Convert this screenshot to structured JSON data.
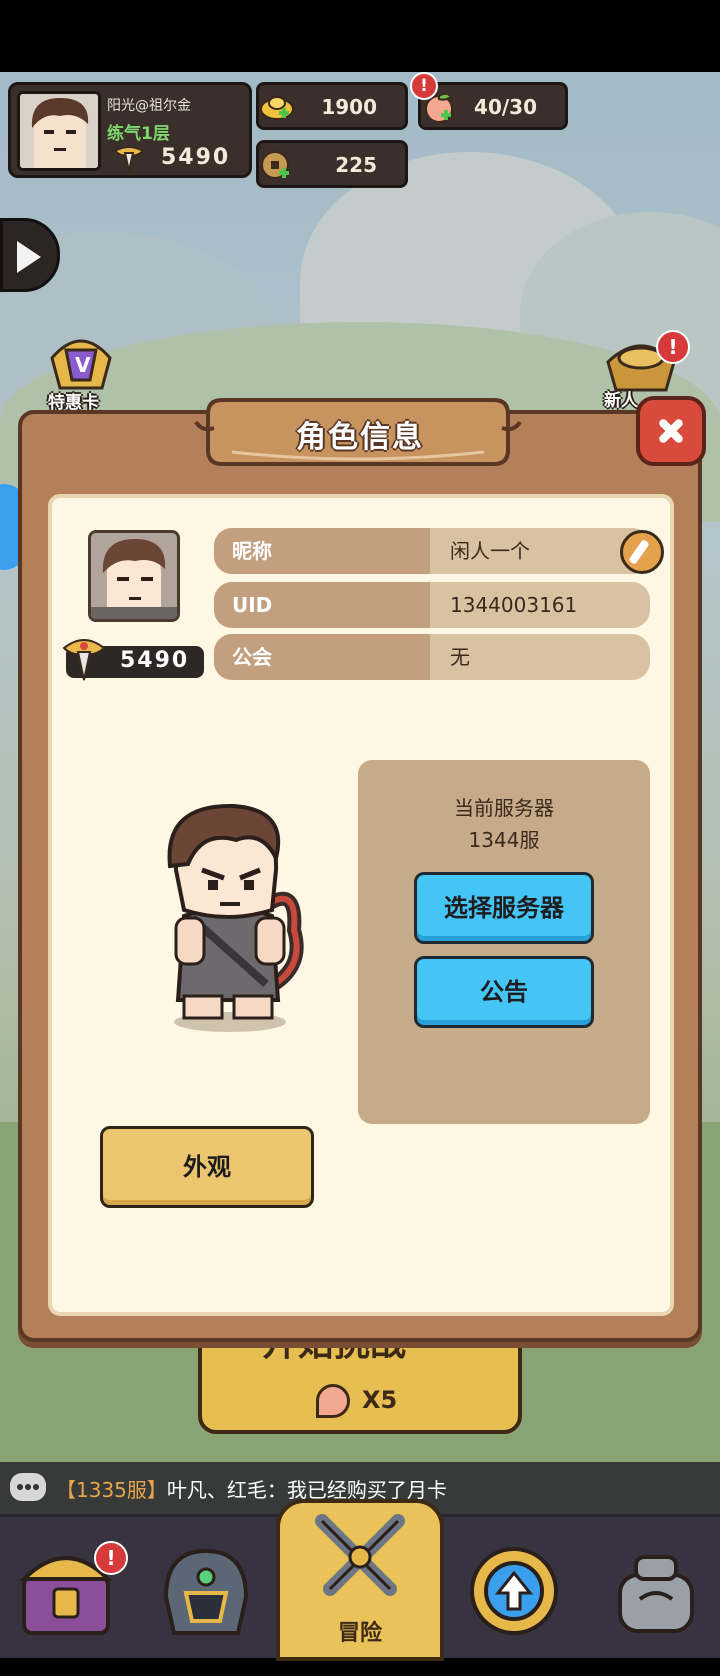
{
  "hud": {
    "player_name": "阳光@祖尔金",
    "player_level": "练气1层",
    "player_power": "5490",
    "gold_ingot": "1900",
    "stamina": "40/30",
    "coins": "225",
    "stamina_badge": "!"
  },
  "side": {
    "special_card_label": "特惠卡",
    "newbie_label": "新人",
    "newbie_badge": "!"
  },
  "dialog": {
    "title": "角色信息",
    "power": "5490",
    "rows": [
      {
        "key": "昵称",
        "value": "闲人一个"
      },
      {
        "key": "UID",
        "value": "1344003161"
      },
      {
        "key": "公会",
        "value": "无"
      }
    ],
    "server_caption": "当前服务器",
    "server_value": "1344服",
    "select_server_label": "选择服务器",
    "notice_label": "公告",
    "appearance_label": "外观"
  },
  "behind": {
    "start_challenge": "开始挑战",
    "cost": "X5"
  },
  "chat": {
    "server_tag": "【1335服】",
    "message": "叶凡、红毛：我已经购买了月卡"
  },
  "nav": {
    "adventure_label": "冒险",
    "shop_badge": "!"
  },
  "colors": {
    "accent_blue": "#45c4f6",
    "panel_brown": "#b4805a",
    "cream": "#fdf7e4",
    "close_red": "#d84a3b"
  }
}
